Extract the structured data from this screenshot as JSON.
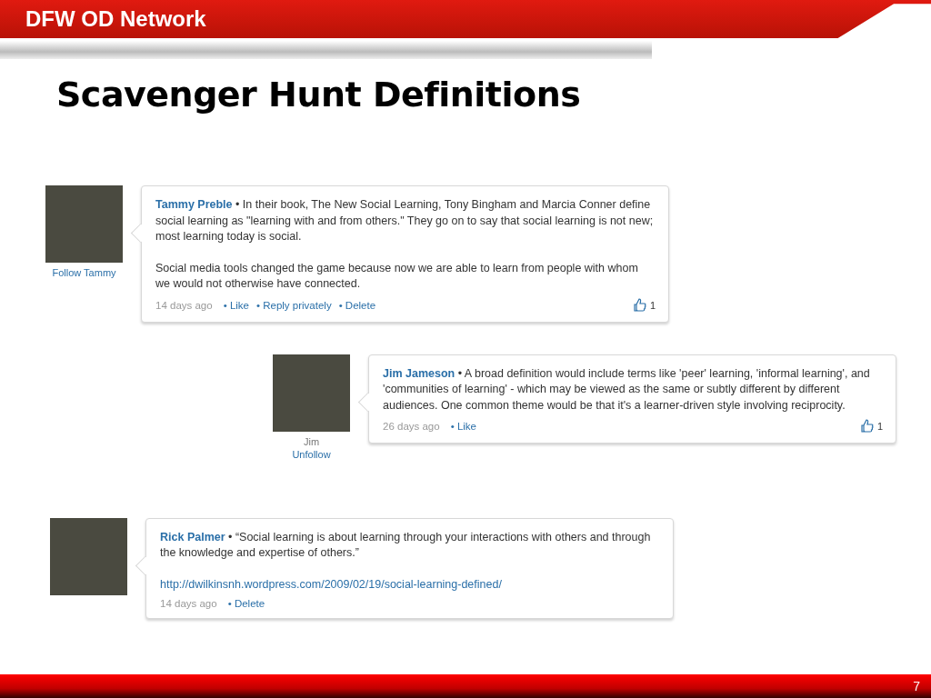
{
  "header": {
    "brand": "DFW OD Network"
  },
  "slide_title": "Scavenger Hunt Definitions",
  "posts": [
    {
      "author": "Tammy Preble",
      "paragraphs": [
        "• In their book, The New Social Learning, Tony Bingham and Marcia Conner define social learning as \"learning with and from others.\" They go on to say that social learning is not new; most learning today is social.",
        "Social media tools changed the game because now we are able to learn from people with whom we would not otherwise have connected."
      ],
      "time": "14 days ago",
      "actions": [
        "• Like",
        "• Reply privately",
        "• Delete"
      ],
      "likes": "1",
      "avatar_caption": [
        {
          "kind": "link",
          "text": "Follow Tammy"
        }
      ]
    },
    {
      "author": "Jim Jameson",
      "paragraphs": [
        "• A broad definition would include terms like 'peer' learning, 'informal learning', and 'communities of learning' - which may be viewed as the same or subtly different by different audiences. One common theme would be that it's a learner-driven style involving reciprocity."
      ],
      "time": "26 days ago",
      "actions": [
        "• Like"
      ],
      "likes": "1",
      "avatar_caption": [
        {
          "kind": "name",
          "text": "Jim"
        },
        {
          "kind": "link",
          "text": "Unfollow"
        }
      ]
    },
    {
      "author": "Rick Palmer",
      "paragraphs": [
        "• “Social learning is about learning through your interactions with others and through the knowledge and expertise of others.”"
      ],
      "link": "http://dwilkinsnh.wordpress.com/2009/02/19/social-learning-defined/",
      "time": "14 days ago",
      "actions": [
        "• Delete"
      ]
    }
  ],
  "footer": {
    "page_number": "7"
  }
}
